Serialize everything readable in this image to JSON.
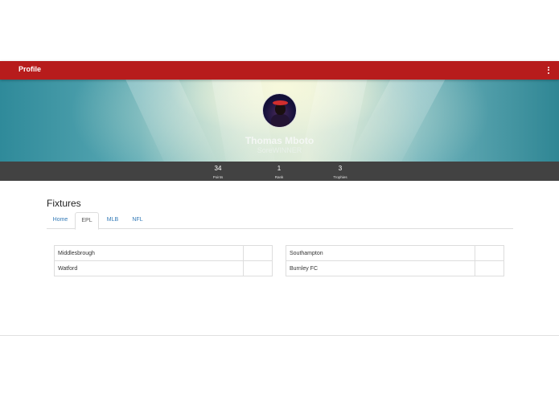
{
  "appbar": {
    "title": "Profile",
    "menu_icon": "more-vert-icon"
  },
  "profile": {
    "name": "Thomas Mboto",
    "handle": "SoreWINNER"
  },
  "stats": [
    {
      "value": "34",
      "label": "Points"
    },
    {
      "value": "1",
      "label": "Rank"
    },
    {
      "value": "3",
      "label": "Trophies"
    }
  ],
  "fixtures": {
    "title": "Fixtures",
    "tabs": [
      {
        "label": "Home",
        "active": false
      },
      {
        "label": "EPL",
        "active": true
      },
      {
        "label": "MLB",
        "active": false
      },
      {
        "label": "NFL",
        "active": false
      }
    ],
    "left_table": [
      {
        "team": "Middlesbrough",
        "score": ""
      },
      {
        "team": "Watford",
        "score": ""
      }
    ],
    "right_table": [
      {
        "team": "Southampton",
        "score": ""
      },
      {
        "team": "Burnley FC",
        "score": ""
      }
    ]
  },
  "colors": {
    "appbar": "#b71c1c",
    "stats_bar": "#424242",
    "link": "#337ab7"
  }
}
